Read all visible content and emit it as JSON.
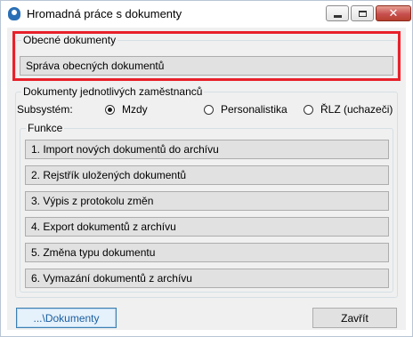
{
  "window": {
    "title": "Hromadná práce s dokumenty",
    "controls": {
      "minimize": "minimize",
      "maximize": "maximize",
      "close": "close"
    }
  },
  "general": {
    "group_title": "Obecné dokumenty",
    "manage_button": "Správa obecných dokumentů",
    "highlight_color": "#e8202a"
  },
  "employees": {
    "group_title": "Dokumenty jednotlivých zaměstnanců",
    "subsystem_label": "Subsystém:",
    "radios": [
      {
        "label": "Mzdy",
        "selected": true
      },
      {
        "label": "Personalistika",
        "selected": false
      },
      {
        "label": "ŘLZ (uchazeči)",
        "selected": false
      }
    ],
    "functions_title": "Funkce",
    "functions": [
      "1. Import nových dokumentů do archívu",
      "2. Rejstřík uložených dokumentů",
      "3. Výpis z protokolu změn",
      "4. Export dokumentů z archívu",
      "5. Změna typu dokumentu",
      "6. Vymazání dokumentů z archívu"
    ]
  },
  "footer": {
    "documents_button": "...\\Dokumenty",
    "close_button": "Zavřít"
  }
}
